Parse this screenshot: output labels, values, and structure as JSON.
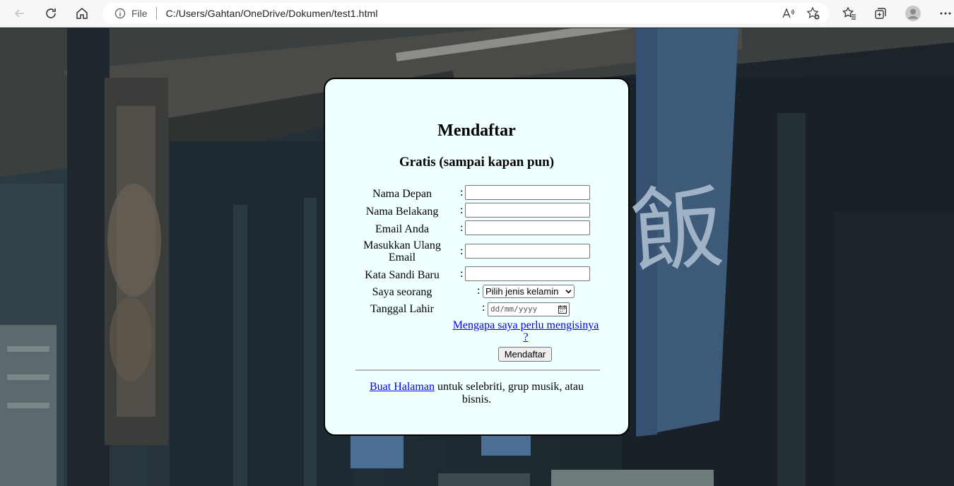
{
  "browser": {
    "scheme_label": "File",
    "url": "C:/Users/Gahtan/OneDrive/Dokumen/test1.html",
    "icons": [
      "back-icon",
      "refresh-icon",
      "home-icon",
      "info-icon",
      "read-aloud-icon",
      "add-favorite-icon",
      "favorites-icon",
      "collections-icon",
      "profile-icon",
      "more-icon"
    ]
  },
  "form": {
    "title": "Mendaftar",
    "subtitle": "Gratis (sampai kapan pun)",
    "separator": ":",
    "fields": {
      "first_name": {
        "label": "Nama Depan",
        "value": ""
      },
      "last_name": {
        "label": "Nama Belakang",
        "value": ""
      },
      "email": {
        "label": "Email Anda",
        "value": ""
      },
      "email_confirm": {
        "label": "Masukkan Ulang Email",
        "value": ""
      },
      "password": {
        "label": "Kata Sandi Baru",
        "value": ""
      },
      "gender": {
        "label": "Saya seorang",
        "selected": "Pilih jenis kelamin"
      },
      "birth_date": {
        "label": "Tanggal Lahir",
        "placeholder": "dd/mm/yyyy"
      }
    },
    "why_link": "Mengapa saya perlu mengisinya ?",
    "submit_label": "Mendaftar",
    "footer_link": "Buat Halaman",
    "footer_text": " untuk selebriti, grup musik, atau bisnis."
  },
  "background": {
    "banner_glyph": "飯",
    "colors": {
      "card": "#f0ffff",
      "banner": "#3d5a78",
      "link": "#0000ee"
    }
  }
}
